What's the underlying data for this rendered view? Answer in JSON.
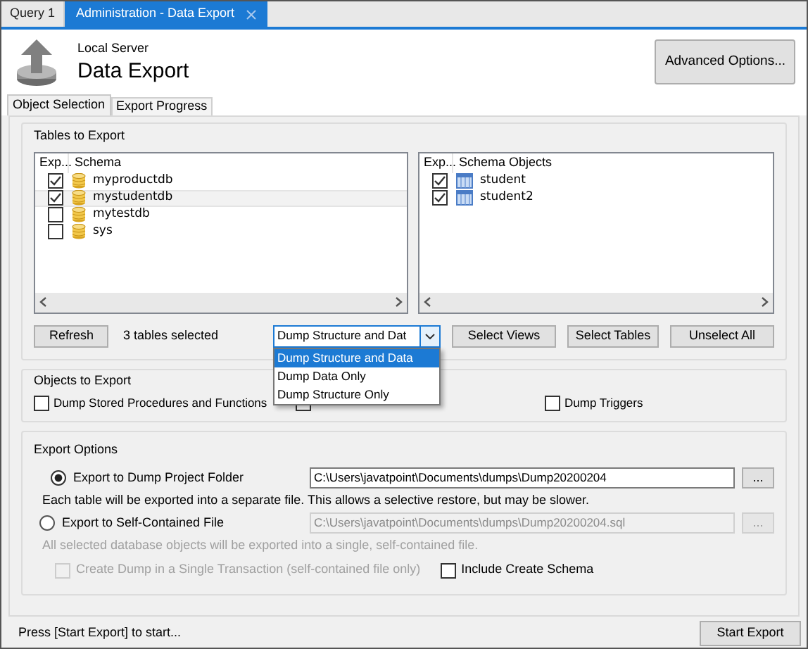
{
  "tabs": [
    {
      "label": "Query 1",
      "selected": false,
      "closable": false
    },
    {
      "label": "Administration - Data Export",
      "selected": true,
      "closable": true
    }
  ],
  "header": {
    "subtitle": "Local Server",
    "title": "Data Export",
    "advanced_button": "Advanced Options..."
  },
  "subtabs": [
    {
      "label": "Object Selection",
      "selected": true
    },
    {
      "label": "Export Progress",
      "selected": false
    }
  ],
  "tables_group": {
    "title": "Tables to Export",
    "schemas": {
      "columns": [
        "Exp...",
        "Schema"
      ],
      "rows": [
        {
          "checked": true,
          "selected": false,
          "name": "myproductdb"
        },
        {
          "checked": true,
          "selected": true,
          "name": "mystudentdb"
        },
        {
          "checked": false,
          "selected": false,
          "name": "mytestdb"
        },
        {
          "checked": false,
          "selected": false,
          "name": "sys"
        }
      ]
    },
    "objects": {
      "columns": [
        "Exp...",
        "Schema Objects"
      ],
      "rows": [
        {
          "checked": true,
          "selected": false,
          "name": "student"
        },
        {
          "checked": true,
          "selected": false,
          "name": "student2"
        }
      ]
    },
    "refresh_button": "Refresh",
    "selection_count": "3 tables selected",
    "dump_select": {
      "value": "Dump Structure and Dat",
      "expanded": true,
      "options": [
        {
          "label": "Dump Structure and Data",
          "selected": true
        },
        {
          "label": "Dump Data Only",
          "selected": false
        },
        {
          "label": "Dump Structure Only",
          "selected": false
        }
      ]
    },
    "buttons": [
      "Select Views",
      "Select Tables",
      "Unselect All"
    ]
  },
  "objects_group": {
    "title": "Objects to Export",
    "options": [
      {
        "label": "Dump Stored Procedures and Functions",
        "checked": false
      },
      {
        "checked": false
      },
      {
        "label": "Dump Triggers",
        "checked": false
      }
    ]
  },
  "export_options": {
    "title": "Export Options",
    "targets": [
      {
        "label": "Export to Dump Project Folder",
        "selected": true,
        "disabled": false,
        "path": "C:\\Users\\javatpoint\\Documents\\dumps\\Dump20200204",
        "browse": "...",
        "note": "Each table will be exported into a separate file. This allows a selective restore, but may be slower."
      },
      {
        "label": "Export to Self-Contained File",
        "selected": false,
        "disabled": true,
        "path": "C:\\Users\\javatpoint\\Documents\\dumps\\Dump20200204.sql",
        "browse": "...",
        "note": "All selected database objects will be exported into a single, self-contained file."
      }
    ],
    "checks": [
      {
        "label": "Create Dump in a Single Transaction (self-contained file only)",
        "checked": false,
        "disabled": true
      },
      {
        "label": "Include Create Schema",
        "checked": false,
        "disabled": false
      }
    ]
  },
  "status": "Press [Start Export] to start...",
  "start_button": "Start Export"
}
